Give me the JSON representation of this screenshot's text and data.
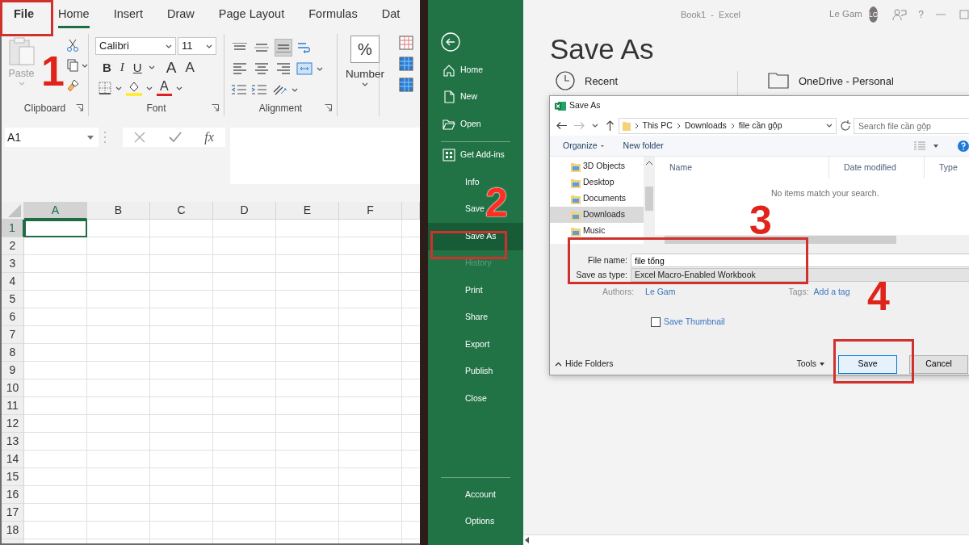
{
  "excel": {
    "tabs": [
      {
        "label": "File",
        "selected": false
      },
      {
        "label": "Home",
        "selected": true
      },
      {
        "label": "Insert",
        "selected": false
      },
      {
        "label": "Draw",
        "selected": false
      },
      {
        "label": "Page Layout",
        "selected": false
      },
      {
        "label": "Formulas",
        "selected": false
      },
      {
        "label": "Dat",
        "selected": false
      }
    ],
    "ribbon": {
      "clipboard": {
        "label": "Clipboard",
        "paste": {
          "label": "Paste",
          "disabled": true
        }
      },
      "font": {
        "label": "Font",
        "name": "Calibri",
        "size": "11",
        "styles": [
          {
            "kind": "bold",
            "label": "B"
          },
          {
            "kind": "italic",
            "label": "I"
          },
          {
            "kind": "underline",
            "label": "U"
          }
        ],
        "grow": "A",
        "shrink": "A",
        "color_letter": "A"
      },
      "alignment": {
        "label": "Alignment",
        "vertical": [
          {
            "kind": "top",
            "selected": false
          },
          {
            "kind": "middle",
            "selected": false
          },
          {
            "kind": "bottom",
            "selected": true
          }
        ],
        "horizontal": [
          {
            "kind": "left",
            "selected": false
          },
          {
            "kind": "center",
            "selected": false
          },
          {
            "kind": "right",
            "selected": false
          }
        ]
      },
      "number": {
        "symbol": "%",
        "label": "Number"
      }
    },
    "name_box": "A1",
    "function_label": "fx",
    "columns": [
      {
        "label": "A",
        "selected": true
      },
      {
        "label": "B",
        "selected": false
      },
      {
        "label": "C",
        "selected": false
      },
      {
        "label": "D",
        "selected": false
      },
      {
        "label": "E",
        "selected": false
      },
      {
        "label": "F",
        "selected": false
      }
    ],
    "rows": [
      {
        "label": "1",
        "selected": true
      },
      {
        "label": "2",
        "selected": false
      },
      {
        "label": "3",
        "selected": false
      },
      {
        "label": "4",
        "selected": false
      },
      {
        "label": "5",
        "selected": false
      },
      {
        "label": "6",
        "selected": false
      },
      {
        "label": "7",
        "selected": false
      },
      {
        "label": "8",
        "selected": false
      },
      {
        "label": "9",
        "selected": false
      },
      {
        "label": "10",
        "selected": false
      },
      {
        "label": "11",
        "selected": false
      },
      {
        "label": "12",
        "selected": false
      },
      {
        "label": "13",
        "selected": false
      },
      {
        "label": "14",
        "selected": false
      },
      {
        "label": "15",
        "selected": false
      },
      {
        "label": "16",
        "selected": false
      },
      {
        "label": "17",
        "selected": false
      },
      {
        "label": "18",
        "selected": false
      }
    ]
  },
  "backstage": {
    "document": "Book1",
    "separator": "-",
    "app": "Excel",
    "user": "Le Gam",
    "avatar": "LG",
    "help": "?",
    "nav_sections": [
      [
        {
          "label": "Home",
          "selected": false,
          "disabled": false
        },
        {
          "label": "New",
          "selected": false,
          "disabled": false
        },
        {
          "label": "Open",
          "selected": false,
          "disabled": false
        }
      ],
      [
        {
          "label": "Get Add-ins",
          "selected": false,
          "disabled": false
        },
        {
          "label": "Info",
          "selected": false,
          "disabled": false
        },
        {
          "label": "Save",
          "selected": false,
          "disabled": false
        },
        {
          "label": "Save As",
          "selected": true,
          "disabled": false
        },
        {
          "label": "History",
          "selected": false,
          "disabled": true
        },
        {
          "label": "Print",
          "selected": false,
          "disabled": false
        },
        {
          "label": "Share",
          "selected": false,
          "disabled": false
        },
        {
          "label": "Export",
          "selected": false,
          "disabled": false
        },
        {
          "label": "Publish",
          "selected": false,
          "disabled": false
        },
        {
          "label": "Close",
          "selected": false,
          "disabled": false
        }
      ],
      [
        {
          "label": "Account",
          "selected": false,
          "disabled": false
        },
        {
          "label": "Options",
          "selected": false,
          "disabled": false
        }
      ]
    ],
    "heading": "Save As",
    "locations": [
      {
        "label": "Recent"
      },
      {
        "label": "OneDrive - Personal"
      }
    ]
  },
  "dialog": {
    "title": "Save As",
    "path": [
      "This PC",
      "Downloads",
      "file cần gộp"
    ],
    "search_placeholder": "Search file cần gộp",
    "organize": "Organize",
    "new_folder": "New folder",
    "folders": [
      {
        "label": "3D Objects",
        "selected": false
      },
      {
        "label": "Desktop",
        "selected": false
      },
      {
        "label": "Documents",
        "selected": false
      },
      {
        "label": "Downloads",
        "selected": true
      },
      {
        "label": "Music",
        "selected": false
      }
    ],
    "columns": [
      "Name",
      "Date modified",
      "Type"
    ],
    "empty_message": "No items match your search.",
    "file_name_label": "File name:",
    "file_name": "file tổng",
    "type_label": "Save as type:",
    "type": "Excel Macro-Enabled Workbook",
    "authors_label": "Authors:",
    "author": "Le Gam",
    "tags_label": "Tags:",
    "tags_placeholder": "Add a tag",
    "thumbnail": {
      "label": "Save Thumbnail",
      "checked": false
    },
    "hide_folders": "Hide Folders",
    "tools": "Tools",
    "save": "Save",
    "cancel": "Cancel"
  },
  "annotations": [
    {
      "label": "1"
    },
    {
      "label": "2"
    },
    {
      "label": "3"
    },
    {
      "label": "4"
    }
  ]
}
